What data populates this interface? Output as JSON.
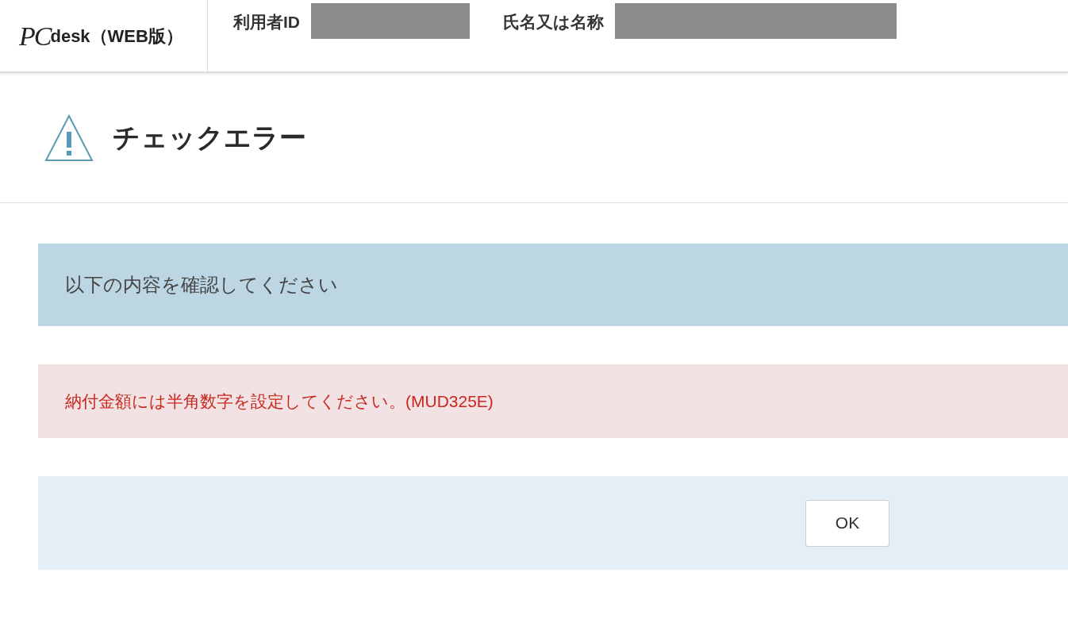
{
  "header": {
    "logo": {
      "mark": "PC",
      "text": "desk（WEB版）"
    },
    "fields": [
      {
        "label": "利用者ID",
        "redacted": true
      },
      {
        "label": "氏名又は名称",
        "redacted": true
      }
    ]
  },
  "dialog": {
    "title": "チェックエラー",
    "info": "以下の内容を確認してください",
    "errors": [
      "納付金額には半角数字を設定してください。(MUD325E)"
    ],
    "buttons": [
      "OK"
    ]
  }
}
